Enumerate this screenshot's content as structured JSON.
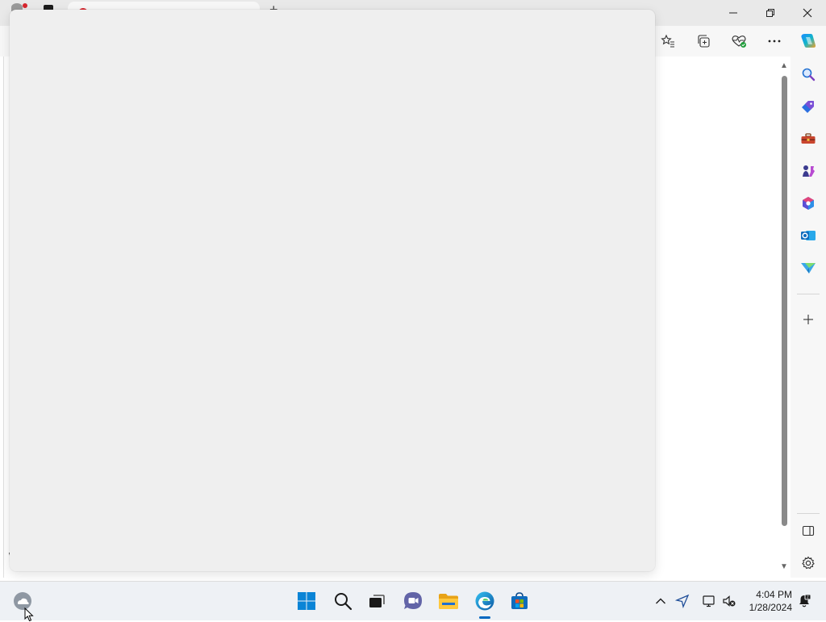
{
  "browser": {
    "active_tab_title": "",
    "new_tab_label": "+"
  },
  "window_controls": {
    "minimize": "—",
    "restore": "❐",
    "close": "✕"
  },
  "page": {
    "edge_char": "\\"
  },
  "taskbar": {
    "time": "4:04 PM",
    "date": "1/28/2024"
  },
  "colors": {
    "accent": "#0067c0",
    "overlay": "#efefef",
    "tab_favicon": "#d8262e"
  }
}
